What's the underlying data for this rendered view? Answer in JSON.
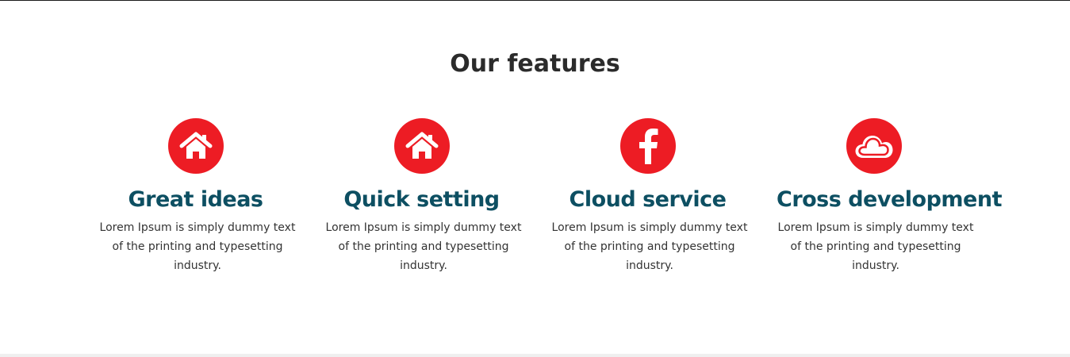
{
  "section": {
    "title": "Our features"
  },
  "theme": {
    "accent_color": "#ed1c24",
    "title_color": "#0d4f62",
    "text_color": "#333333"
  },
  "features": [
    {
      "icon": "home-icon",
      "title": "Great ideas",
      "text": "Lorem Ipsum is simply dummy text of the printing and typesetting industry."
    },
    {
      "icon": "home-icon",
      "title": "Quick setting",
      "text": "Lorem Ipsum is simply dummy text of the printing and typesetting industry."
    },
    {
      "icon": "facebook-icon",
      "title": "Cloud service",
      "text": "Lorem Ipsum is simply dummy text of the printing and typesetting industry."
    },
    {
      "icon": "cloud-icon",
      "title": "Cross development",
      "text": "Lorem Ipsum is simply dummy text of the printing and typesetting industry."
    }
  ]
}
